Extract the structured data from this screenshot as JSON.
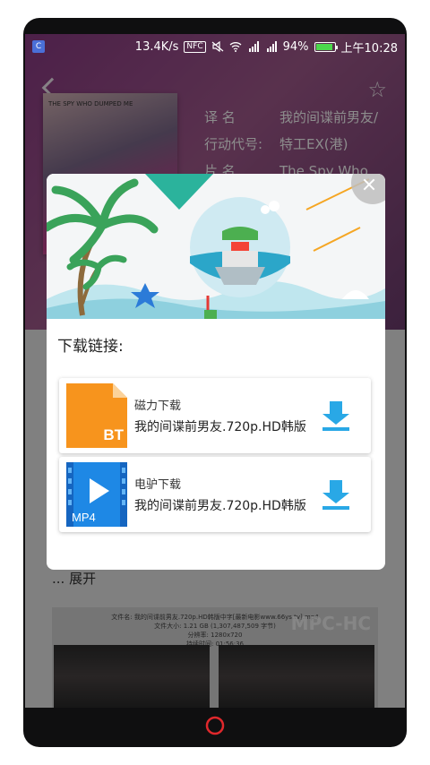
{
  "status_bar": {
    "app_badge": "C",
    "net_speed": "13.4K/s",
    "nfc": "NFC",
    "battery_text": "94%",
    "battery_level": 0.94,
    "time": "上午10:28"
  },
  "background": {
    "poster_caption": "THE SPY WHO DUMPED ME",
    "info_rows": [
      {
        "key": "译    名",
        "value": "我的间谍前男友/"
      },
      {
        "key": "行动代号:",
        "value": "特工EX(港)"
      },
      {
        "key": "片    名",
        "value": "The Spy Who"
      }
    ],
    "expand_label": "... 展开",
    "video": {
      "meta": [
        "文件名: 我的间谍前男友.720p.HD韩版中字[最新电影www.66ys.tv].mp4",
        "文件大小: 1.21 GB (1,307,487,509 字节)",
        "分辨率: 1280x720",
        "持续时间: 01:56:36"
      ],
      "watermark": "MPC-HC"
    }
  },
  "dialog": {
    "title": "下载链接:",
    "items": [
      {
        "type_label": "磁力下载",
        "file_name": "我的间谍前男友.720p.HD韩版",
        "badge": "BT",
        "badge_color": "#f7941d"
      },
      {
        "type_label": "电驴下载",
        "file_name": "我的间谍前男友.720p.HD韩版",
        "badge": "MP4",
        "badge_color": "#1e88e5"
      }
    ],
    "download_icon_color": "#29a8e6"
  },
  "nav": {
    "home_icon": "home-circle-icon"
  }
}
